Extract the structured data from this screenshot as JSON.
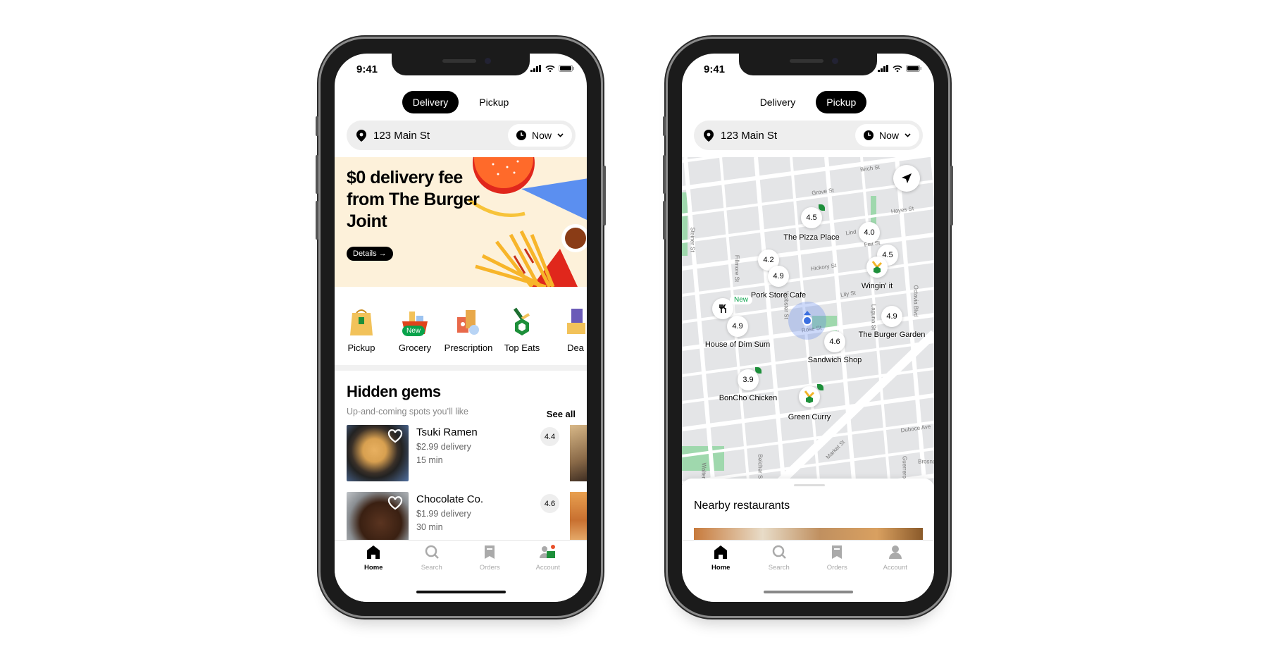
{
  "status": {
    "time": "9:41"
  },
  "mode_toggle": {
    "delivery": "Delivery",
    "pickup": "Pickup"
  },
  "address_bar": {
    "address": "123 Main St",
    "time_option": "Now"
  },
  "banner": {
    "headline": "$0 delivery fee from The Burger Joint",
    "cta": "Details →"
  },
  "categories": [
    {
      "label": "Pickup",
      "icon": "shopping-bag-icon"
    },
    {
      "label": "Grocery",
      "icon": "grocery-basket-icon",
      "badge": "New"
    },
    {
      "label": "Prescription",
      "icon": "prescription-icon"
    },
    {
      "label": "Top Eats",
      "icon": "top-eats-icon"
    },
    {
      "label": "Dea",
      "icon": "deals-icon"
    }
  ],
  "hidden_gems": {
    "title": "Hidden gems",
    "subtitle": "Up-and-coming spots you’ll like",
    "see_all": "See all",
    "items": [
      {
        "name": "Tsuki Ramen",
        "fee": "$2.99 delivery",
        "time": "15 min",
        "rating": "4.4"
      },
      {
        "name": "Chocolate Co.",
        "fee": "$1.99 delivery",
        "time": "30 min",
        "rating": "4.6"
      }
    ]
  },
  "tabbar": [
    {
      "label": "Home",
      "icon": "home-icon",
      "active": true
    },
    {
      "label": "Search",
      "icon": "search-icon"
    },
    {
      "label": "Orders",
      "icon": "receipt-icon"
    },
    {
      "label": "Account",
      "icon": "account-icon"
    }
  ],
  "map": {
    "pins": [
      {
        "rating": "4.5",
        "name": "The Pizza Place"
      },
      {
        "rating": "4.0",
        "name": ""
      },
      {
        "rating": "4.5",
        "name": "Wingin' it"
      },
      {
        "rating": "4.2",
        "name": ""
      },
      {
        "rating": "4.9",
        "name": "Pork Store Cafe"
      },
      {
        "rating": "4.9",
        "name": "House of Dim Sum",
        "badge": "New"
      },
      {
        "rating": "4.6",
        "name": "Sandwich Shop"
      },
      {
        "rating": "4.9",
        "name": "The Burger Garden"
      },
      {
        "rating": "3.9",
        "name": "BonCho Chicken"
      },
      {
        "rating": "",
        "name": "Green Curry"
      }
    ],
    "streets": [
      "Birch St",
      "Grove St",
      "Hayes St",
      "Lind",
      "Fell St",
      "Hickory St",
      "Lily St",
      "Rose St",
      "Steiner St",
      "Fillmore St",
      "Webster St",
      "Laguna St",
      "Octavia Blvd",
      "Duboce Ave",
      "Market St",
      "Belcher St",
      "Guerrero",
      "Walter",
      "Brosnan"
    ],
    "colors": {
      "land": "#e4e5e7",
      "park": "#9fd8ad",
      "user_location": "#3b6fe0"
    }
  },
  "sheet": {
    "title": "Nearby restaurants"
  }
}
